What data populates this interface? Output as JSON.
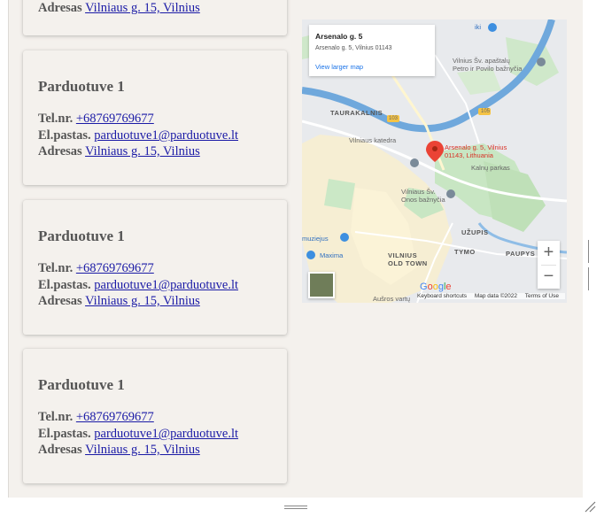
{
  "top_partial_card": {
    "label": "Adresas",
    "address": "Vilniaus g. 15, Vilnius"
  },
  "cards": [
    {
      "title": "Parduotuve 1",
      "tel_label": "Tel.nr.",
      "tel": "+68769769677",
      "email_label": "El.pastas.",
      "email": "parduotuve1@parduotuve.lt",
      "address_label": "Adresas",
      "address": "Vilniaus g. 15, Vilnius"
    },
    {
      "title": "Parduotuve 1",
      "tel_label": "Tel.nr.",
      "tel": "+68769769677",
      "email_label": "El.pastas.",
      "email": "parduotuve1@parduotuve.lt",
      "address_label": "Adresas",
      "address": "Vilniaus g. 15, Vilnius"
    },
    {
      "title": "Parduotuve 1",
      "tel_label": "Tel.nr.",
      "tel": "+68769769677",
      "email_label": "El.pastas.",
      "email": "parduotuve1@parduotuve.lt",
      "address_label": "Adresas",
      "address": "Vilniaus g. 15, Vilnius"
    }
  ],
  "map": {
    "place_name": "Arsenalo g. 5",
    "place_address": "Arsenalo g. 5, Vilnius 01143",
    "larger_map_link": "View larger map",
    "marker_label_1": "Arsenalo g. 5, Vilnius",
    "marker_label_2": "01143, Lithuania",
    "labels": {
      "taurakalnis": "TAURAKALNIS",
      "katedra": "Vilniaus katedra",
      "kalnu_parkas": "Kalnų parkas",
      "onos_1": "Vilniaus Šv.",
      "onos_2": "Onos bažnyčia",
      "uzupis": "UŽUPIS",
      "tymo": "TYMO",
      "paupys": "PAUPYS",
      "maxima": "Maxima",
      "muziejus": "muziejus",
      "vilnius": "VILNIUS",
      "old_town": "OLD TOWN",
      "ausros": "Aušros vartų",
      "apastalu_1": "Vilnius Šv. apaštalų",
      "apastalu_2": "Petro ir Povilo bažnyčia",
      "iki": "iki",
      "road_103": "103",
      "road_105": "105"
    },
    "google": "Google",
    "attribution": [
      "Keyboard shortcuts",
      "Map data ©2022",
      "Terms of Use"
    ],
    "zoom_in": "+",
    "zoom_out": "−"
  },
  "icons": [
    "zoom-in-icon",
    "zoom-out-icon",
    "map-pin-icon",
    "resize-grip-icon",
    "scroll-grip-icon"
  ]
}
